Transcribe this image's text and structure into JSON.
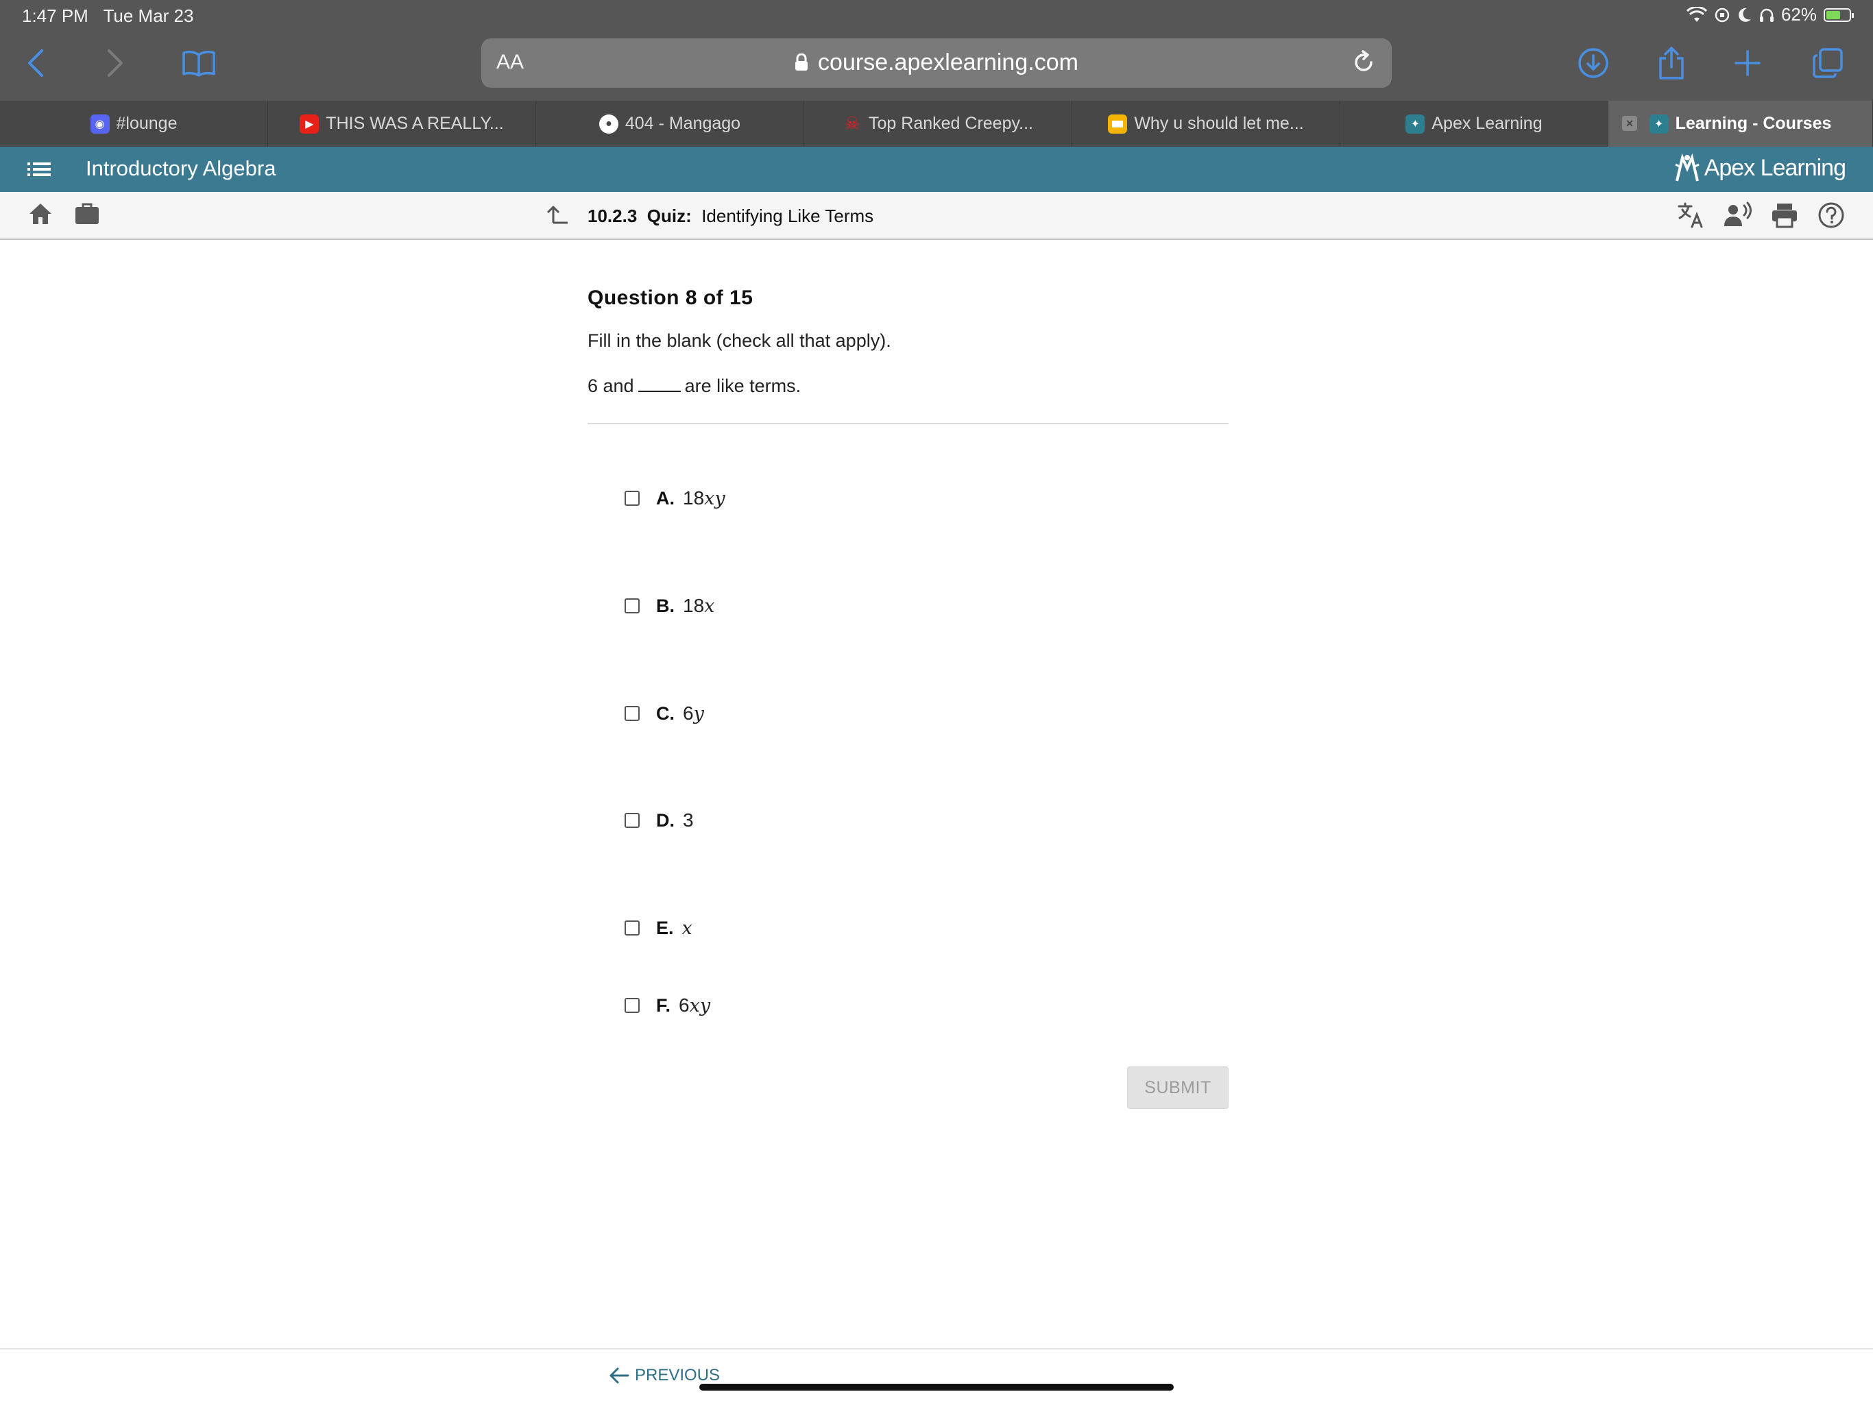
{
  "status_bar": {
    "time": "1:47 PM",
    "date": "Tue Mar 23",
    "battery": "62%",
    "battery_level": 0.62
  },
  "browser": {
    "aa_label": "AA",
    "url": "course.apexlearning.com",
    "tabs": [
      {
        "label": "#lounge",
        "icon": "discord-icon"
      },
      {
        "label": "THIS WAS A REALLY...",
        "icon": "youtube-icon"
      },
      {
        "label": "404 - Mangago",
        "icon": "reddit-icon"
      },
      {
        "label": "Top Ranked Creepy...",
        "icon": "skull-icon"
      },
      {
        "label": "Why u should let me...",
        "icon": "slides-icon"
      },
      {
        "label": "Apex Learning",
        "icon": "apex-icon"
      },
      {
        "label": "Learning - Courses",
        "icon": "apex-icon",
        "active": true
      }
    ]
  },
  "app": {
    "course_title": "Introductory Algebra",
    "logo_text": "Apex Learning",
    "brand_color": "#3b7a91"
  },
  "toolbar": {
    "lesson_number": "10.2.3",
    "lesson_type": "Quiz:",
    "lesson_title": "Identifying Like Terms"
  },
  "question": {
    "number_label": "Question 8 of 15",
    "instruction": "Fill in the blank (check all that apply).",
    "prompt_before": "6 and",
    "prompt_after": "are like terms.",
    "options": [
      {
        "letter": "A.",
        "coef": "18",
        "var": "xy",
        "checked": false
      },
      {
        "letter": "B.",
        "coef": "18",
        "var": "x",
        "checked": false
      },
      {
        "letter": "C.",
        "coef": "6",
        "var": "y",
        "checked": false
      },
      {
        "letter": "D.",
        "coef": "3",
        "var": "",
        "checked": false
      },
      {
        "letter": "E.",
        "coef": "",
        "var": "x",
        "checked": false
      },
      {
        "letter": "F.",
        "coef": "6",
        "var": "xy",
        "checked": false
      }
    ],
    "submit_label": "SUBMIT"
  },
  "footer": {
    "previous_label": "PREVIOUS"
  }
}
